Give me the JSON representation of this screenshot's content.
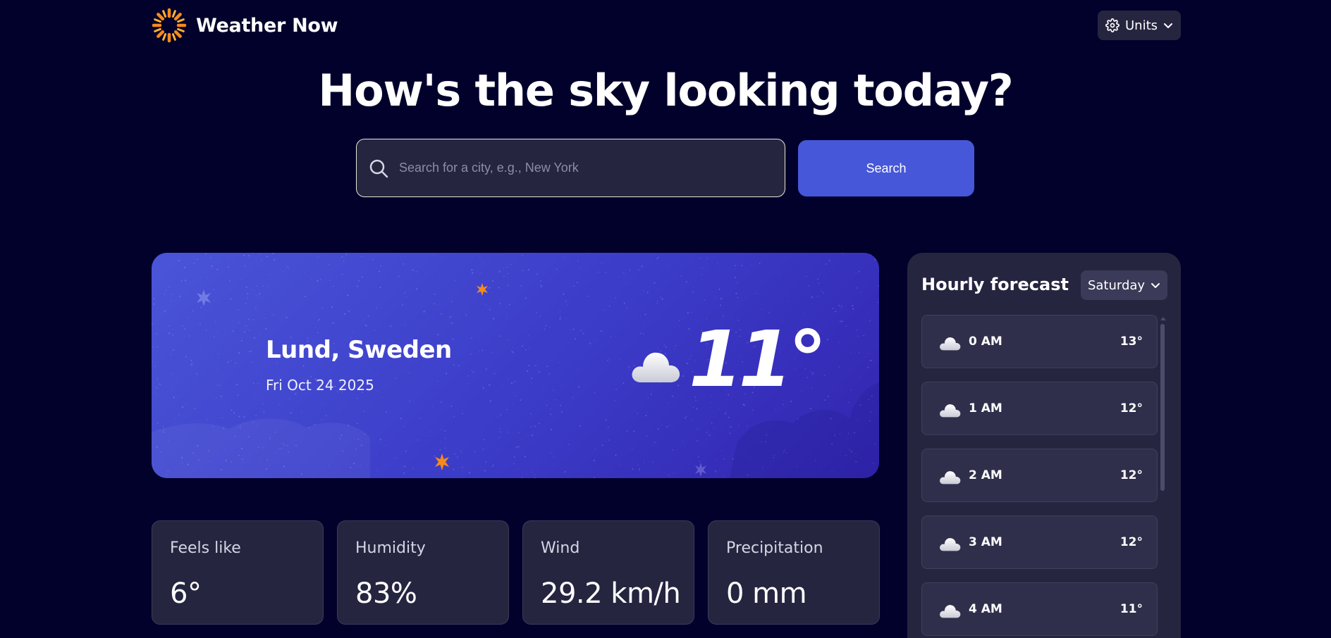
{
  "header": {
    "app_name": "Weather Now",
    "logo_icon": "sun-logo-icon",
    "units_label": "Units"
  },
  "headline": "How's the sky looking today?",
  "search": {
    "placeholder": "Search for a city, e.g., New York",
    "value": "",
    "button_label": "Search"
  },
  "current": {
    "city": "Lund, Sweden",
    "date": "Fri Oct 24 2025",
    "temperature": "11°",
    "condition_icon": "cloud-icon"
  },
  "stats": [
    {
      "label": "Feels like",
      "value": "6°"
    },
    {
      "label": "Humidity",
      "value": "83%"
    },
    {
      "label": "Wind",
      "value": "29.2 km/h"
    },
    {
      "label": "Precipitation",
      "value": "0 mm"
    }
  ],
  "hourly": {
    "title": "Hourly forecast",
    "selected_day": "Saturday",
    "items": [
      {
        "time": "0 AM",
        "temp": "13°",
        "icon": "cloud-icon"
      },
      {
        "time": "1 AM",
        "temp": "12°",
        "icon": "cloud-icon"
      },
      {
        "time": "2 AM",
        "temp": "12°",
        "icon": "cloud-icon"
      },
      {
        "time": "3 AM",
        "temp": "12°",
        "icon": "cloud-icon"
      },
      {
        "time": "4 AM",
        "temp": "11°",
        "icon": "cloud-icon"
      }
    ]
  },
  "colors": {
    "background": "#02012b",
    "card": "#262540",
    "accent": "#4657d9",
    "sun_orange": "#f78a1c"
  }
}
